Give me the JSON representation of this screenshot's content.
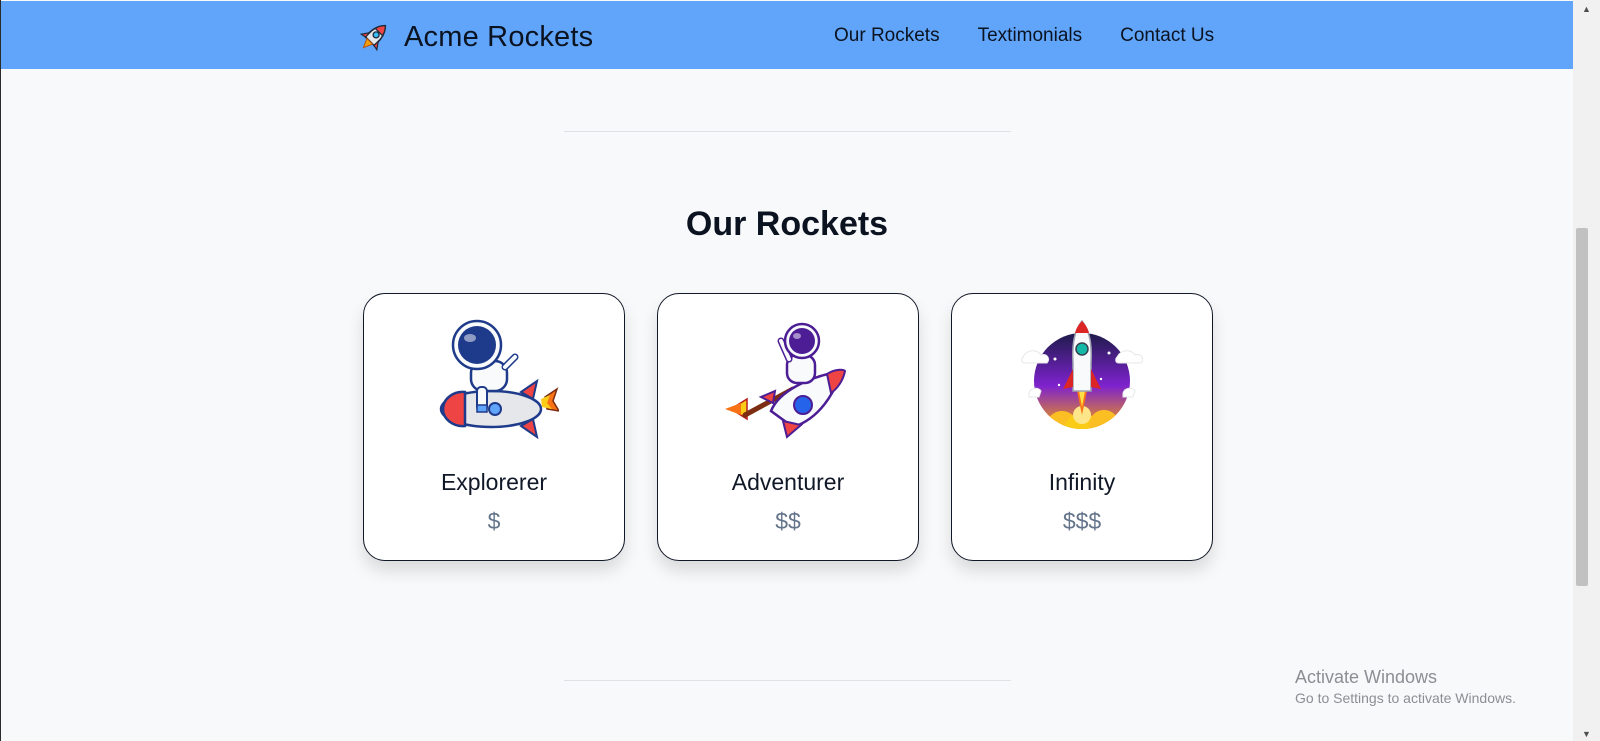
{
  "navbar": {
    "brand_icon": "rocket-icon",
    "brand_name": "Acme Rockets",
    "links": [
      {
        "label": "Our Rockets"
      },
      {
        "label": "Textimonials"
      },
      {
        "label": "Contact Us"
      }
    ],
    "background_color": "#60a5fa"
  },
  "section": {
    "title": "Our Rockets"
  },
  "rockets": [
    {
      "name": "Explorerer",
      "price": "$",
      "image": "astronaut-riding-rocket-illustration"
    },
    {
      "name": "Adventurer",
      "price": "$$",
      "image": "astronaut-waving-on-rocket-illustration"
    },
    {
      "name": "Infinity",
      "price": "$$$",
      "image": "rocket-launch-night-sky-illustration"
    }
  ],
  "watermark": {
    "title": "Activate Windows",
    "subtitle": "Go to Settings to activate Windows."
  }
}
